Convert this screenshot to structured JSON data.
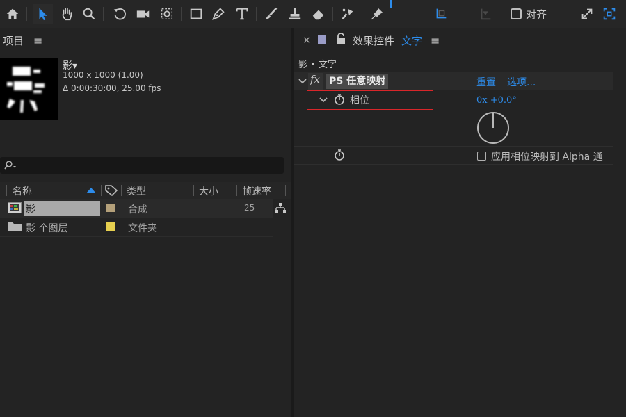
{
  "toolbar": {
    "icons": [
      "home-icon",
      "selection-tool-icon",
      "hand-tool-icon",
      "zoom-tool-icon",
      "rotate-tool-icon",
      "camera-tool-icon",
      "pan-behind-tool-icon",
      "rectangle-tool-icon",
      "pen-tool-icon",
      "type-tool-icon",
      "brush-tool-icon",
      "clone-stamp-tool-icon",
      "eraser-tool-icon",
      "roto-brush-tool-icon",
      "puppet-pin-tool-icon",
      "axis-icon",
      "snap-icon",
      "expand-icon",
      "workspace-icon"
    ],
    "snap_label": "对齐"
  },
  "project": {
    "title": "项目",
    "comp_name": "影▾",
    "comp_size": "1000 x 1000 (1.00)",
    "comp_duration": "Δ 0:00:30:00, 25.00 fps",
    "search_placeholder": "",
    "columns": [
      "名称",
      "类型",
      "大小",
      "帧速率"
    ],
    "items": [
      {
        "name": "影",
        "label_color": "#b4a07a",
        "type": "合成",
        "size": "",
        "fps": "25"
      },
      {
        "name": "影 个图层",
        "label_color": "#e6cf4f",
        "type": "文件夹",
        "size": "",
        "fps": ""
      }
    ]
  },
  "effects": {
    "close": "×",
    "title": "效果控件",
    "layer_name": "文字",
    "breadcrumb": "影 • 文字",
    "fx_label": "fx",
    "effect_name": "PS 任意映射",
    "reset_label": "重置",
    "options_label": "选项...",
    "phase_label": "相位",
    "phase_value": "0x +0.0°",
    "alpha_label": "应用相位映射到 Alpha 通"
  },
  "colors": {
    "accent": "#2d8ceb",
    "highlight_box": "#d9262a",
    "panel_bg": "#232323"
  }
}
